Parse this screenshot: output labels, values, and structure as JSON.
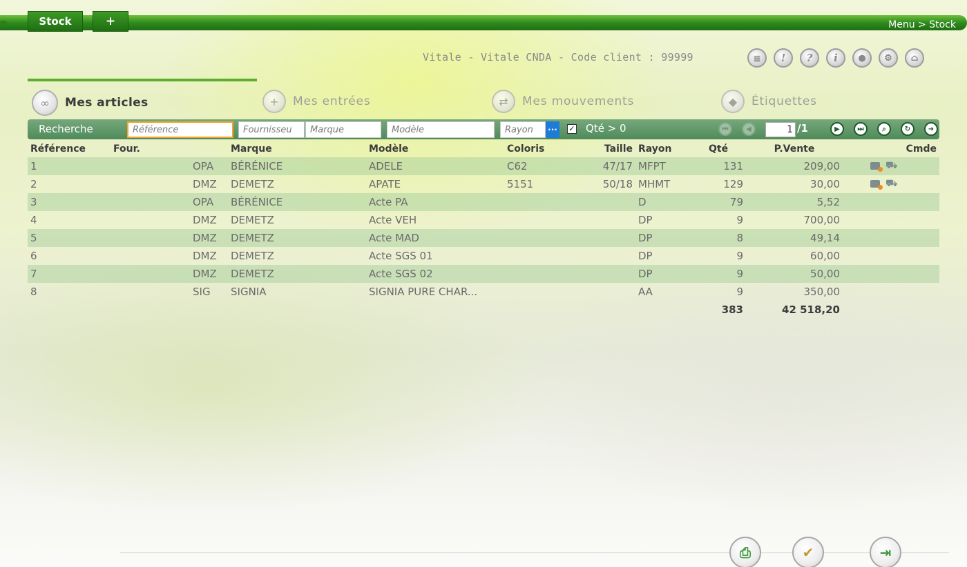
{
  "header": {
    "tab_stock": "Stock",
    "tab_plus": "+",
    "breadcrumb": "Menu > Stock"
  },
  "client_info": "Vitale - Vitale CNDA - Code client : 99999",
  "top_icons": [
    "calendar-icon",
    "alert-icon",
    "help-icon",
    "info-icon",
    "user-icon",
    "tools-icon",
    "home-icon"
  ],
  "nav": {
    "articles": "Mes articles",
    "entrees": "Mes entrées",
    "mouvements": "Mes mouvements",
    "etiquettes": "Étiquettes"
  },
  "search": {
    "label": "Recherche",
    "reference_placeholder": "Référence",
    "fournisseur_placeholder": "Fournisseu",
    "marque_placeholder": "Marque",
    "modele_placeholder": "Modèle",
    "rayon_placeholder": "Rayon",
    "dots": "···",
    "qty_filter_label": "Qté > 0",
    "qty_filter_checked": true,
    "page_current": "1",
    "page_total": "/1"
  },
  "table": {
    "headers": {
      "reference": "Référence",
      "four": "Four.",
      "marque": "Marque",
      "modele": "Modèle",
      "coloris": "Coloris",
      "taille": "Taille",
      "rayon": "Rayon",
      "qte": "Qté",
      "prix": "P.Vente",
      "cmde": "Cmde"
    },
    "rows": [
      {
        "ref": "1",
        "four": "OPA",
        "marque": "BÉRÉNICE",
        "modele": "ADELE",
        "coloris": "C62",
        "taille": "47/17",
        "rayon": "MFPT",
        "qte": "131",
        "prix": "209,00",
        "cmde": true
      },
      {
        "ref": "2",
        "four": "DMZ",
        "marque": "DEMETZ",
        "modele": "APATE",
        "coloris": "5151",
        "taille": "50/18",
        "rayon": "MHMT",
        "qte": "129",
        "prix": "30,00",
        "cmde": true
      },
      {
        "ref": "3",
        "four": "OPA",
        "marque": "BÉRÉNICE",
        "modele": "Acte PA",
        "coloris": "",
        "taille": "",
        "rayon": "D",
        "qte": "79",
        "prix": "5,52",
        "cmde": false
      },
      {
        "ref": "4",
        "four": "DMZ",
        "marque": "DEMETZ",
        "modele": "Acte VEH",
        "coloris": "",
        "taille": "",
        "rayon": "DP",
        "qte": "9",
        "prix": "700,00",
        "cmde": false
      },
      {
        "ref": "5",
        "four": "DMZ",
        "marque": "DEMETZ",
        "modele": "Acte MAD",
        "coloris": "",
        "taille": "",
        "rayon": "DP",
        "qte": "8",
        "prix": "49,14",
        "cmde": false
      },
      {
        "ref": "6",
        "four": "DMZ",
        "marque": "DEMETZ",
        "modele": "Acte SGS 01",
        "coloris": "",
        "taille": "",
        "rayon": "DP",
        "qte": "9",
        "prix": "60,00",
        "cmde": false
      },
      {
        "ref": "7",
        "four": "DMZ",
        "marque": "DEMETZ",
        "modele": "Acte SGS 02",
        "coloris": "",
        "taille": "",
        "rayon": "DP",
        "qte": "9",
        "prix": "50,00",
        "cmde": false
      },
      {
        "ref": "8",
        "four": "SIG",
        "marque": "SIGNIA",
        "modele": "SIGNIA PURE CHAR...",
        "coloris": "",
        "taille": "",
        "rayon": "AA",
        "qte": "9",
        "prix": "350,00",
        "cmde": false
      }
    ],
    "totals": {
      "qte": "383",
      "prix": "42 518,20"
    }
  },
  "bottom_buttons": [
    "print-icon",
    "validate-icon",
    "exit-icon"
  ],
  "colors": {
    "bar_green": "#2e8b1e",
    "search_bar": "#5f9a68",
    "row_highlight": "#a0cd96",
    "focus_orange": "#f2a52b"
  }
}
